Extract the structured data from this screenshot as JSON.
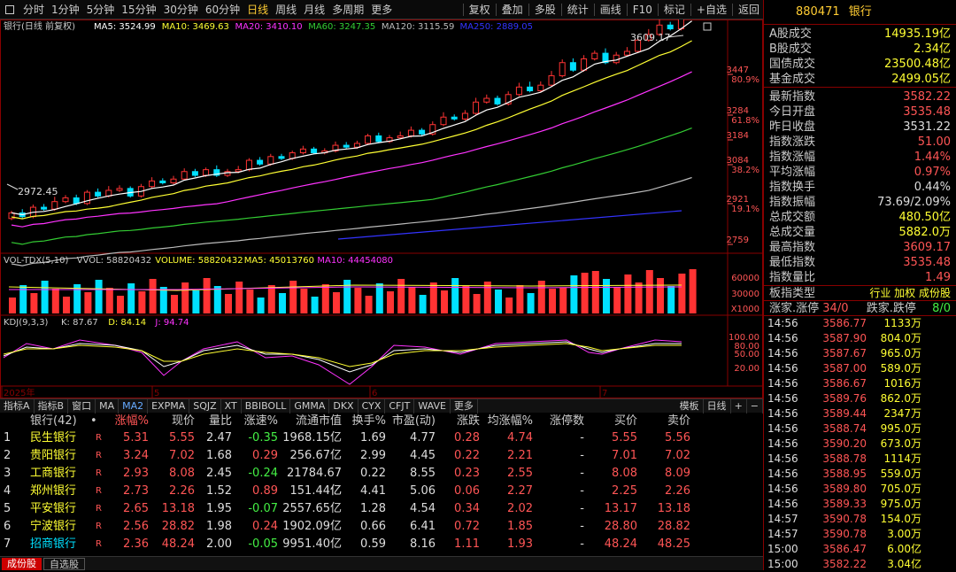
{
  "toolbar": {
    "items": [
      "分时",
      "1分钟",
      "5分钟",
      "15分钟",
      "30分钟",
      "60分钟",
      "日线",
      "周线",
      "月线",
      "多周期",
      "更多"
    ],
    "active": "日线",
    "right_items": [
      "复权",
      "叠加",
      "多股",
      "统计",
      "画线",
      "F10",
      "标记",
      "+自选",
      "返回"
    ]
  },
  "chart": {
    "header_name": "银行(日线 前复权)",
    "ma": [
      {
        "label": "MA5: 3524.99",
        "color": "#ffffff"
      },
      {
        "label": "MA10: 3469.63",
        "color": "#ffff33"
      },
      {
        "label": "MA20: 3410.10",
        "color": "#ff33ff"
      },
      {
        "label": "MA60: 3247.35",
        "color": "#33cc33"
      },
      {
        "label": "MA120: 3115.59",
        "color": "#bbbbbb"
      },
      {
        "label": "MA250: 2889.05",
        "color": "#3333ff"
      }
    ],
    "high_label": "3609.17",
    "low_label": "2972.45",
    "y_labels": [
      {
        "price": "3447",
        "pct": "80.9%"
      },
      {
        "price": "3284",
        "pct": "61.8%"
      },
      {
        "price": "3184",
        "pct": ""
      },
      {
        "price": "3084",
        "pct": "38.2%"
      },
      {
        "price": "2921",
        "pct": "19.1%"
      },
      {
        "price": "2759",
        "pct": ""
      }
    ],
    "vol_header": {
      "name": "VOL-TDX(5,10)",
      "vvol": "VVOL: 58820432",
      "volume": "VOLUME: 58820432",
      "ma5": "MA5: 45013760",
      "ma10": "MA10: 44454080"
    },
    "vol_labels": [
      "60000",
      "30000",
      "X1000"
    ],
    "kdj_header": {
      "name": "KDJ(9,3,3)",
      "k": "K: 87.67",
      "d": "D: 84.14",
      "j": "J: 94.74"
    },
    "kdj_labels": [
      "100.00",
      "80.00",
      "50.00",
      "20.00"
    ],
    "date_labels": [
      "2025年",
      "5",
      "6",
      "7"
    ]
  },
  "tabs": [
    "指标A",
    "指标B",
    "窗口",
    "MA",
    "MA2",
    "EXPMA",
    "SQJZ",
    "XT",
    "BBIBOLL",
    "GMMA",
    "DKX",
    "CYX",
    "CFJT",
    "WAVE",
    "更多"
  ],
  "tabs_active": "MA2",
  "tabs_right": [
    "模板",
    "日线",
    "+",
    "−"
  ],
  "table": {
    "headers": [
      "",
      "银行(42)",
      "•",
      "涨幅%",
      "现价",
      "量比",
      "涨速%",
      "流通市值",
      "换手%",
      "市盈(动)",
      "涨跌",
      "均涨幅%",
      "涨停数",
      "买价",
      "卖价"
    ],
    "rows": [
      [
        "1",
        "民生银行",
        "R",
        "5.31",
        "5.55",
        "2.47",
        "-0.35",
        "1968.15亿",
        "1.69",
        "4.77",
        "0.28",
        "4.74",
        "-",
        "5.55",
        "5.56"
      ],
      [
        "2",
        "贵阳银行",
        "R",
        "3.24",
        "7.02",
        "1.68",
        "0.29",
        "256.67亿",
        "2.99",
        "4.45",
        "0.22",
        "2.21",
        "-",
        "7.01",
        "7.02"
      ],
      [
        "3",
        "工商银行",
        "R",
        "2.93",
        "8.08",
        "2.45",
        "-0.24",
        "21784.67亿",
        "0.22",
        "8.55",
        "0.23",
        "2.55",
        "-",
        "8.08",
        "8.09"
      ],
      [
        "4",
        "郑州银行",
        "R",
        "2.73",
        "2.26",
        "1.52",
        "0.89",
        "151.44亿",
        "4.41",
        "5.06",
        "0.06",
        "2.27",
        "-",
        "2.25",
        "2.26"
      ],
      [
        "5",
        "平安银行",
        "R",
        "2.65",
        "13.18",
        "1.95",
        "-0.07",
        "2557.65亿",
        "1.28",
        "4.54",
        "0.34",
        "2.02",
        "-",
        "13.17",
        "13.18"
      ],
      [
        "6",
        "宁波银行",
        "R",
        "2.56",
        "28.82",
        "1.98",
        "0.24",
        "1902.09亿",
        "0.66",
        "6.41",
        "0.72",
        "1.85",
        "-",
        "28.80",
        "28.82"
      ],
      [
        "7",
        "招商银行",
        "R",
        "2.36",
        "48.24",
        "2.00",
        "-0.05",
        "9951.40亿",
        "0.59",
        "8.16",
        "1.11",
        "1.93",
        "-",
        "48.24",
        "48.25"
      ]
    ]
  },
  "statusbar": {
    "items": [
      "成份股",
      "自选股"
    ]
  },
  "panel": {
    "code": "880471",
    "name": "银行",
    "stats1": [
      {
        "k": "A股成交",
        "v": "14935.19亿"
      },
      {
        "k": "B股成交",
        "v": "2.34亿"
      },
      {
        "k": "国债成交",
        "v": "23500.48亿"
      },
      {
        "k": "基金成交",
        "v": "2499.05亿"
      }
    ],
    "stats2": [
      {
        "k": "最新指数",
        "v": "3582.22",
        "c": "red"
      },
      {
        "k": "今日开盘",
        "v": "3535.48",
        "c": "red"
      },
      {
        "k": "昨日收盘",
        "v": "3531.22",
        "c": "white"
      },
      {
        "k": "指数涨跌",
        "v": "51.00",
        "c": "red"
      },
      {
        "k": "指数涨幅",
        "v": "1.44%",
        "c": "red"
      },
      {
        "k": "平均涨幅",
        "v": "0.97%",
        "c": "red"
      },
      {
        "k": "指数换手",
        "v": "0.44%",
        "c": "white"
      },
      {
        "k": "指数振幅",
        "v": "73.69/2.09%",
        "c": "white"
      },
      {
        "k": "总成交额",
        "v": "480.50亿",
        "c": "yellow"
      },
      {
        "k": "总成交量",
        "v": "5882.0万",
        "c": "yellow"
      },
      {
        "k": "最高指数",
        "v": "3609.17",
        "c": "red"
      },
      {
        "k": "最低指数",
        "v": "3535.48",
        "c": "red"
      },
      {
        "k": "指数量比",
        "v": "1.49",
        "c": "red"
      }
    ],
    "board_type": {
      "k": "板指类型",
      "v": "行业 加权 成份股"
    },
    "limit": {
      "k1": "涨家.涨停",
      "v1": "34/0",
      "k2": "跌家.跌停",
      "v2": "8/0"
    },
    "ticks": [
      [
        "14:56",
        "3586.77",
        "1133万"
      ],
      [
        "14:56",
        "3587.90",
        "804.0万"
      ],
      [
        "14:56",
        "3587.67",
        "965.0万"
      ],
      [
        "14:56",
        "3587.00",
        "589.0万"
      ],
      [
        "14:56",
        "3586.67",
        "1016万"
      ],
      [
        "14:56",
        "3589.76",
        "862.0万"
      ],
      [
        "14:56",
        "3589.44",
        "2347万"
      ],
      [
        "14:56",
        "3588.74",
        "995.0万"
      ],
      [
        "14:56",
        "3590.20",
        "673.0万"
      ],
      [
        "14:56",
        "3588.78",
        "1114万"
      ],
      [
        "14:56",
        "3588.95",
        "559.0万"
      ],
      [
        "14:56",
        "3589.80",
        "705.0万"
      ],
      [
        "14:56",
        "3589.33",
        "975.0万"
      ],
      [
        "14:57",
        "3590.78",
        "154.0万"
      ],
      [
        "14:57",
        "3590.78",
        "3.00万"
      ],
      [
        "15:00",
        "3586.47",
        "6.00亿"
      ],
      [
        "15:00",
        "3582.22",
        "3.04亿"
      ]
    ]
  }
}
